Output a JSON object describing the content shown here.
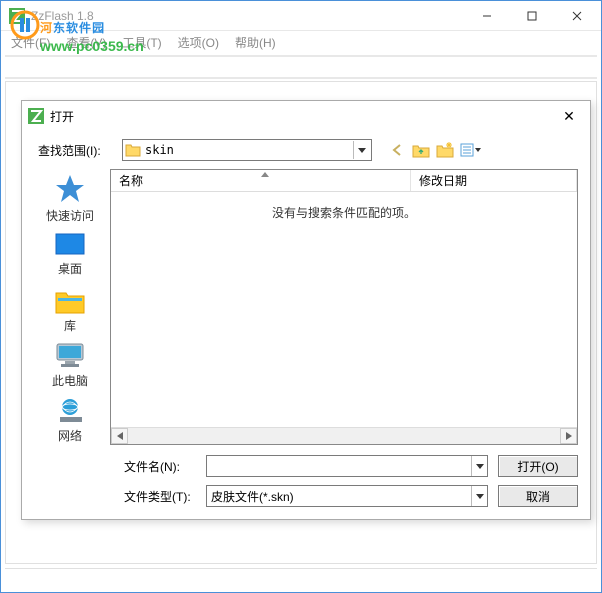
{
  "main": {
    "title": "ZzFlash 1.8",
    "menu": {
      "file": "文件(F)",
      "view": "查看(V)",
      "tools": "工具(T)",
      "options": "选项(O)",
      "help": "帮助(H)"
    }
  },
  "watermark": {
    "text1a": "河",
    "text1b": "东",
    "text1c": "软",
    "text1d": "件",
    "text1e": "园",
    "url": "www.pc0359.cn"
  },
  "dialog": {
    "title": "打开",
    "lookin_label": "查找范围(I):",
    "lookin_value": "skin",
    "columns": {
      "name": "名称",
      "date": "修改日期"
    },
    "empty_msg": "没有与搜索条件匹配的项。",
    "filename_label": "文件名(N):",
    "filename_value": "",
    "filetype_label": "文件类型(T):",
    "filetype_value": "皮肤文件(*.skn)",
    "open_btn": "打开(O)",
    "cancel_btn": "取消"
  },
  "places": {
    "quick": "快速访问",
    "desktop": "桌面",
    "libraries": "库",
    "thispc": "此电脑",
    "network": "网络"
  }
}
